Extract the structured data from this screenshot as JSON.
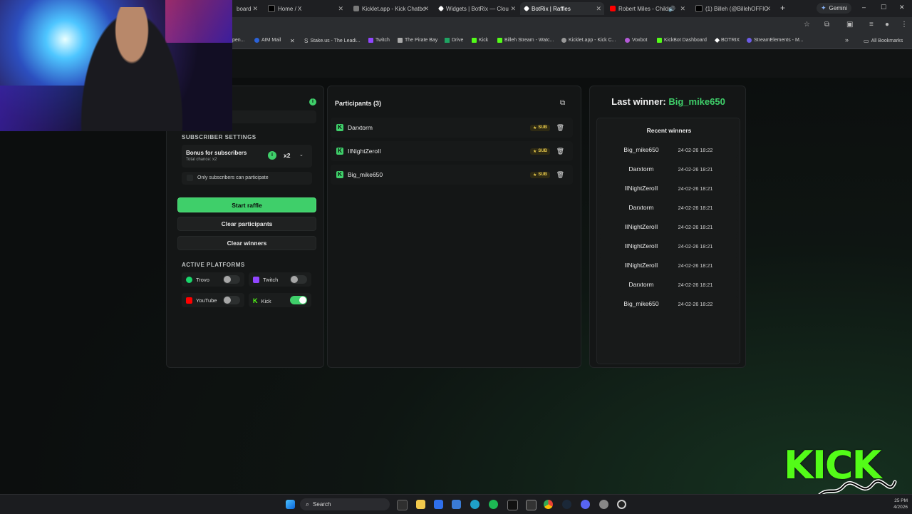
{
  "browser": {
    "tabs": [
      {
        "label": "board",
        "fav_color": "#3a3a3a",
        "active": false
      },
      {
        "label": "Home / X",
        "fav_color": "#000000",
        "active": false
      },
      {
        "label": "Kicklet.app - Kick Chatbo",
        "fav_color": "#7a7a7a",
        "active": false
      },
      {
        "label": "Widgets | BotRix — Clou",
        "fav_color": "#ffffff",
        "active": false
      },
      {
        "label": "BotRix | Raffles",
        "fav_color": "#ffffff",
        "active": true
      },
      {
        "label": "Robert Miles - Childr",
        "fav_color": "#ff0000",
        "active": false
      },
      {
        "label": "(1) Billeh (@BillehOFFIC",
        "fav_color": "#000000",
        "active": false
      }
    ],
    "new_tab": "+",
    "gemini_label": "Gemini",
    "window_controls": [
      "–",
      "☐",
      "✕"
    ],
    "bookmarks": [
      {
        "label": "pen...",
        "color": "#888888"
      },
      {
        "label": "AIM Mail",
        "color": "#2b62d9"
      },
      {
        "label": "",
        "color": "#000000",
        "icon": "x-icon"
      },
      {
        "label": "Stake.us - The Leadi...",
        "color": "#cccccc"
      },
      {
        "label": "Twitch",
        "color": "#9146ff"
      },
      {
        "label": "The Pirate Bay",
        "color": "#aaaaaa"
      },
      {
        "label": "Drive",
        "color": "#1fa463"
      },
      {
        "label": "Kick",
        "color": "#53fc18"
      },
      {
        "label": "Billeh Stream - Watc...",
        "color": "#53fc18"
      },
      {
        "label": "Kicklet.app - Kick C...",
        "color": "#999999"
      },
      {
        "label": "Voxbot",
        "color": "#b45ad8"
      },
      {
        "label": "KickBot Dashboard",
        "color": "#53fc18"
      },
      {
        "label": "BOTRIX",
        "color": "#ffffff"
      },
      {
        "label": "StreamElements - M...",
        "color": "#6c5ce7"
      }
    ],
    "more_bookmarks": "»",
    "all_bookmarks": "All Bookmarks"
  },
  "left_panel": {
    "subscriber_settings_title": "SUBSCRIBER SETTINGS",
    "bonus_title": "Bonus for subscribers",
    "bonus_sub": "Total chance: x2",
    "multiplier": "x2",
    "only_subs_label": "Only subscribers can participate",
    "start_button": "Start raffle",
    "clear_participants_button": "Clear participants",
    "clear_winners_button": "Clear winners",
    "active_platforms_title": "ACTIVE PLATFORMS",
    "platforms": [
      {
        "name": "Trovo",
        "color": "#19d66b",
        "enabled": false
      },
      {
        "name": "Twitch",
        "color": "#9146ff",
        "enabled": false
      },
      {
        "name": "YouTube",
        "color": "#ff0000",
        "enabled": false
      },
      {
        "name": "Kick",
        "color": "#53fc18",
        "enabled": true
      }
    ]
  },
  "participants": {
    "title": "Participants (3)",
    "sub_badge": "SUB",
    "items": [
      {
        "name": "Darxtorm"
      },
      {
        "name": "IINightZeroII"
      },
      {
        "name": "Big_mike650"
      }
    ]
  },
  "winners": {
    "last_winner_prefix": "Last winner:",
    "last_winner_name": "Big_mike650",
    "recent_title": "Recent winners",
    "items": [
      {
        "name": "Big_mike650",
        "time": "24-02-26 18:22"
      },
      {
        "name": "Darxtorm",
        "time": "24-02-26 18:21"
      },
      {
        "name": "IINightZeroII",
        "time": "24-02-26 18:21"
      },
      {
        "name": "Darxtorm",
        "time": "24-02-26 18:21"
      },
      {
        "name": "IINightZeroII",
        "time": "24-02-26 18:21"
      },
      {
        "name": "IINightZeroII",
        "time": "24-02-26 18:21"
      },
      {
        "name": "IINightZeroII",
        "time": "24-02-26 18:21"
      },
      {
        "name": "Darxtorm",
        "time": "24-02-26 18:21"
      },
      {
        "name": "Big_mike650",
        "time": "24-02-26 18:22"
      }
    ]
  },
  "overlay": {
    "logo_text": "KICK",
    "signature": "BILLEH"
  },
  "taskbar": {
    "search_label": "Search",
    "time": "25 PM",
    "date": "4/2026"
  },
  "colors": {
    "accent": "#3fcf6a",
    "kick_green": "#53fc18",
    "sub_gold": "#e6c84b"
  }
}
